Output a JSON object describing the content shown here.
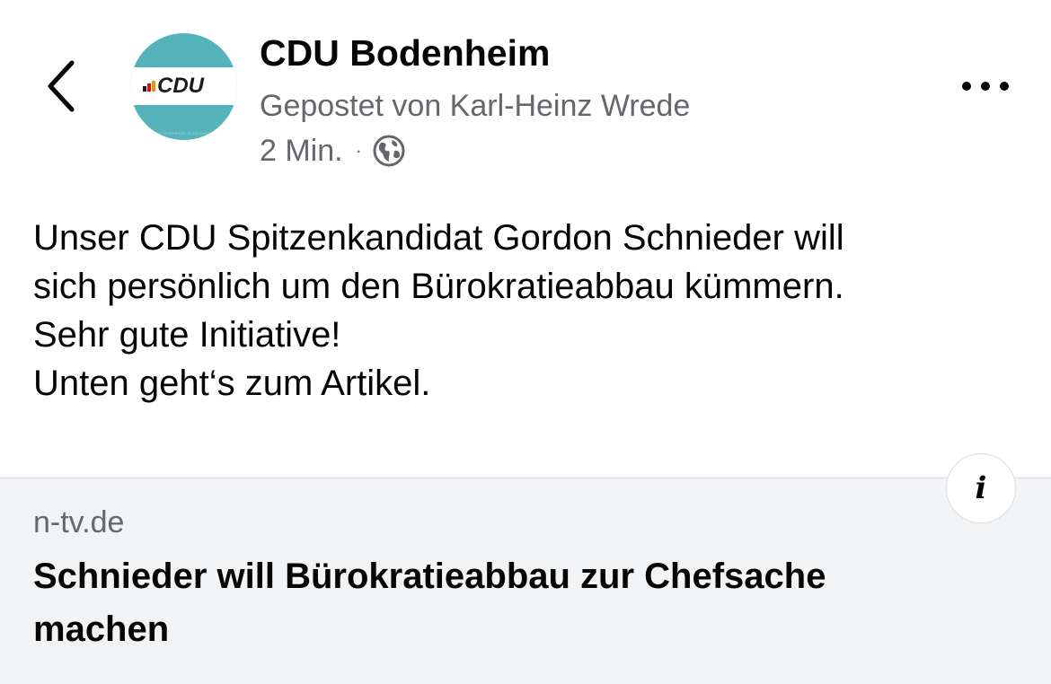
{
  "header": {
    "page_name": "CDU Bodenheim",
    "posted_by": "Gepostet von Karl-Heinz Wrede",
    "time_ago": "2 Min.",
    "separator": "·",
    "audience_icon": "globe-icon",
    "back_icon": "chevron-left-icon",
    "more_icon": "more-horizontal-icon",
    "avatar": {
      "logo_text": "CDU",
      "subtitle": "ORTSVERBAND BODENHEIM",
      "background_color": "#55b3bb"
    }
  },
  "post": {
    "lines": [
      "Unser CDU Spitzenkandidat Gordon Schnieder will",
      "sich persönlich um den Bürokratieabbau kümmern.",
      "Sehr gute Initiative!",
      "Unten geht‘s zum Artikel."
    ]
  },
  "link_preview": {
    "domain": "n-tv.de",
    "title_lines": [
      "Schnieder will Bürokratieabbau zur Chefsache",
      "machen"
    ],
    "info_label": "i",
    "background_color": "#f2f3f5"
  },
  "colors": {
    "text_primary": "#050505",
    "text_secondary": "#65676b",
    "cdu_orange": "#f39200",
    "cdu_red": "#e30613",
    "cdu_black": "#1a1a1a"
  }
}
